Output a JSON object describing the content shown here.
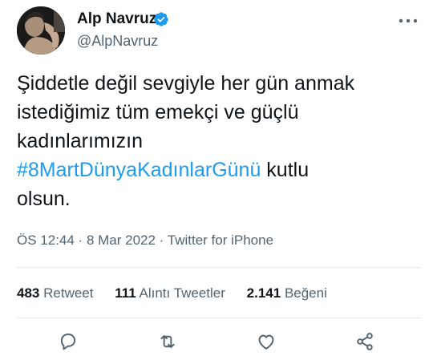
{
  "author": {
    "name": "Alp Navruz",
    "handle": "@AlpNavruz",
    "verified": true
  },
  "tweet": {
    "text_line1": "Şiddetle değil sevgiyle her gün anmak",
    "text_line2": "istediğimiz tüm emekçi ve güçlü",
    "text_line3": "kadınlarımızın",
    "hashtag": "#8MartDünyaKadınlarGünü",
    "text_after_hashtag": " kutlu",
    "text_line5": "olsun."
  },
  "meta": {
    "time": "ÖS 12:44",
    "separator1": " · ",
    "date": "8 Mar 2022",
    "separator2": " · ",
    "source": "Twitter for iPhone"
  },
  "stats": {
    "retweets_count": "483",
    "retweets_label": "Retweet",
    "quotes_count": "111",
    "quotes_label": "Alıntı Tweetler",
    "likes_count": "2.141",
    "likes_label": "Beğeni"
  },
  "icons": {
    "more": "more-horizontal-icon",
    "verified": "verified-badge-icon",
    "reply": "reply-icon",
    "retweet": "retweet-icon",
    "like": "like-icon",
    "share": "share-icon"
  },
  "colors": {
    "accent": "#1d9bf0",
    "text_primary": "#0f1419",
    "text_secondary": "#536471",
    "divider": "#e6ecf0"
  }
}
